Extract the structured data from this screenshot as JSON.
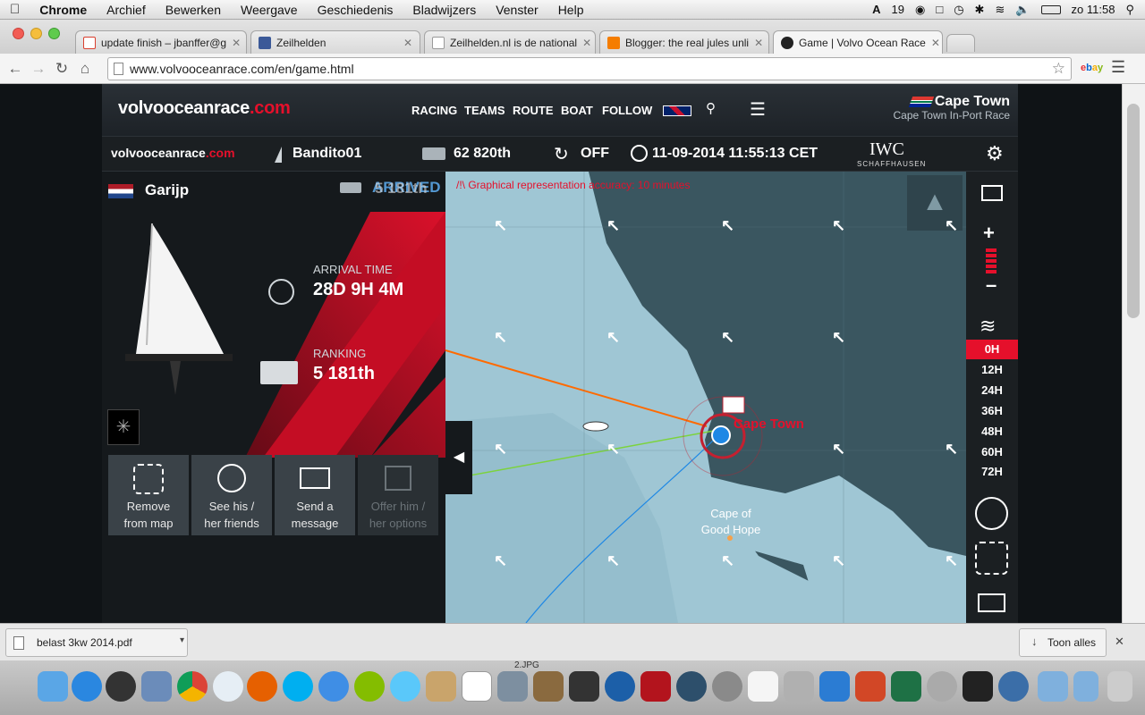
{
  "menubar": {
    "app": "Chrome",
    "items": [
      "Archief",
      "Bewerken",
      "Weergave",
      "Geschiedenis",
      "Bladwijzers",
      "Venster",
      "Help"
    ],
    "badge_count": "19",
    "clock": "zo 11:58"
  },
  "tabs": [
    {
      "title": "update finish – jbanffer@g",
      "color": "#d9402f"
    },
    {
      "title": "Zeilhelden",
      "color": "#3b5998"
    },
    {
      "title": "Zeilhelden.nl is de national",
      "color": "#cccccc"
    },
    {
      "title": "Blogger: the real jules unli",
      "color": "#f57d00"
    },
    {
      "title": "Game | Volvo Ocean Race",
      "color": "#222222"
    }
  ],
  "address": {
    "url": "www.volvooceanrace.com/en/game.html"
  },
  "site": {
    "brand_main": "volvooceanrace",
    "brand_suffix": ".com",
    "nav": [
      "RACING",
      "TEAMS",
      "ROUTE",
      "BOAT",
      "FOLLOW"
    ],
    "event_title": "Cape Town",
    "event_subtitle": "Cape Town In-Port Race"
  },
  "gamebar": {
    "brand_main": "volvooceanrace",
    "brand_suffix": ".com",
    "username": "Bandito01",
    "rank": "62 820th",
    "sync": "OFF",
    "datetime": "11-09-2014 11:55:13 CET",
    "sponsor": "IWC",
    "sponsor_sub": "SCHAFFHAUSEN"
  },
  "boat": {
    "name": "Garijp",
    "status": "ARRIVED",
    "status_rank": "5 181th",
    "arrival_label": "ARRIVAL TIME",
    "arrival_value": "28D 9H 4M",
    "ranking_label": "RANKING",
    "ranking_value": "5 181th"
  },
  "actions": [
    {
      "line1": "Remove",
      "line2": "from map"
    },
    {
      "line1": "See his /",
      "line2": "her friends"
    },
    {
      "line1": "Send a",
      "line2": "message"
    },
    {
      "line1": "Offer him /",
      "line2": "her options"
    }
  ],
  "map": {
    "warning": "/!\\ Graphical representation accuracy: 10 minutes",
    "destination": "Cape Town",
    "place": "Cape of Good Hope"
  },
  "forecast_hours": [
    "0H",
    "12H",
    "24H",
    "36H",
    "48H",
    "60H",
    "72H"
  ],
  "download": {
    "file": "belast 3kw 2014.pdf",
    "show_all": "Toon alles"
  },
  "dock": {
    "caption": "2.JPG"
  },
  "colors": {
    "accent": "#e5102b",
    "sea": "#9fc6d4",
    "land": "#3a5660"
  }
}
